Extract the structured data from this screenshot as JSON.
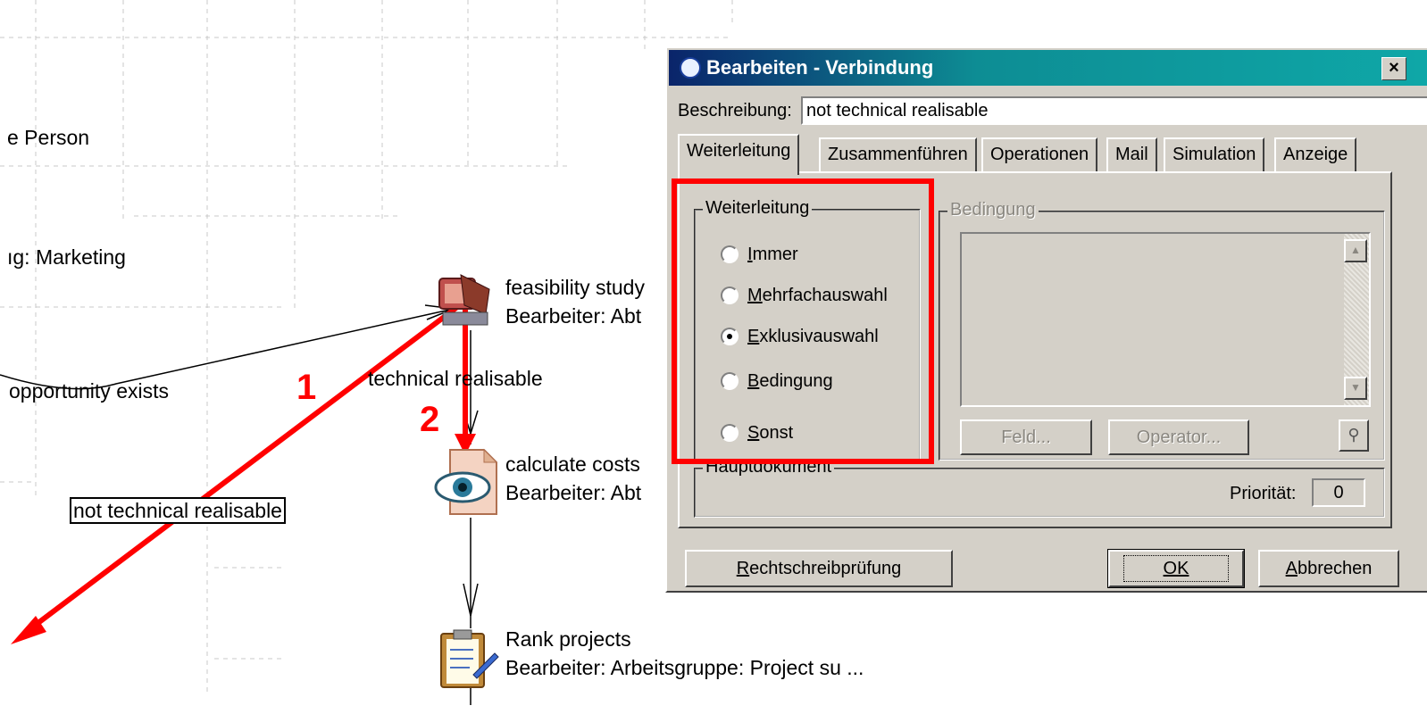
{
  "diagram": {
    "partial_labels": {
      "person": "e Person",
      "marketing": "ıg: Marketing",
      "opportunity": "opportunity exists"
    },
    "edge_labels": {
      "technical_realisable": "technical realisable",
      "not_technical_realisable": "not technical realisable"
    },
    "nodes": [
      {
        "title": "feasibility study",
        "subtitle": "Bearbeiter: Abt",
        "icon": "computer-icon"
      },
      {
        "title": "calculate costs",
        "subtitle": "Bearbeiter: Abt",
        "icon": "document-eye-icon"
      },
      {
        "title": "Rank projects",
        "subtitle": "Bearbeiter: Arbeitsgruppe: Project su ...",
        "icon": "clipboard-icon"
      }
    ],
    "annotations": {
      "arrow1": "1",
      "arrow2": "2",
      "color": "#ff0000"
    }
  },
  "dialog": {
    "title": "Bearbeiten - Verbindung",
    "close_label": "×",
    "description_label": "Beschreibung:",
    "description_value": "not technical realisable",
    "tabs": [
      {
        "label": "Weiterleitung",
        "active": true
      },
      {
        "label": "Zusammenführen"
      },
      {
        "label": "Operationen"
      },
      {
        "label": "Mail"
      },
      {
        "label": "Simulation"
      },
      {
        "label": "Anzeige"
      }
    ],
    "routing_group": {
      "legend": "Weiterleitung",
      "options": [
        {
          "ul": "I",
          "rest": "mmer",
          "selected": false
        },
        {
          "ul": "M",
          "rest": "ehrfachauswahl",
          "selected": false
        },
        {
          "ul": "E",
          "rest": "xklusivauswahl",
          "selected": true
        },
        {
          "ul": "B",
          "rest": "edingung",
          "selected": false
        },
        {
          "ul": "S",
          "rest": "onst",
          "selected": false
        }
      ]
    },
    "condition_group": {
      "legend": "Bedingung",
      "field_button": "Feld...",
      "operator_button": "Operator..."
    },
    "main_doc_group": {
      "legend": "Hauptdokument",
      "priority_label": "Priorität:",
      "priority_value": "0"
    },
    "buttons": {
      "spellcheck": "Rechtschreibprüfung",
      "ok": "OK",
      "cancel": "Abbrechen"
    }
  }
}
